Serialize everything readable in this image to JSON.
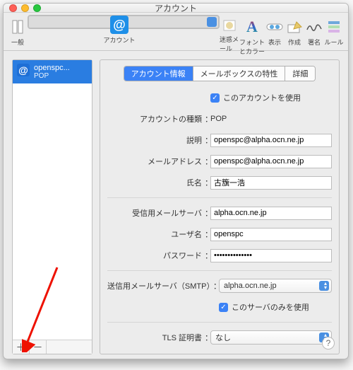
{
  "window": {
    "title": "アカウント"
  },
  "toolbar": {
    "items": [
      {
        "label": "一般"
      },
      {
        "label": "アカウント"
      },
      {
        "label": "迷惑メール"
      },
      {
        "label": "フォントとカラー"
      },
      {
        "label": "表示"
      },
      {
        "label": "作成"
      },
      {
        "label": "署名"
      },
      {
        "label": "ルール"
      }
    ]
  },
  "sidebar": {
    "accounts": [
      {
        "name": "openspc...",
        "type": "POP"
      }
    ],
    "add": "＋",
    "remove": "－"
  },
  "tabs": {
    "info": "アカウント情報",
    "mailbox": "メールボックスの特性",
    "details": "詳細"
  },
  "form": {
    "enable_label": "このアカウントを使用",
    "type_label": "アカウントの種類",
    "type_value": "POP",
    "desc_label": "説明",
    "desc_value": "openspc@alpha.ocn.ne.jp",
    "email_label": "メールアドレス",
    "email_value": "openspc@alpha.ocn.ne.jp",
    "fullname_label": "氏名",
    "fullname_value": "古籏一浩",
    "incoming_label": "受信用メールサーバ",
    "incoming_value": "alpha.ocn.ne.jp",
    "user_label": "ユーザ名",
    "user_value": "openspc",
    "pass_label": "パスワード",
    "pass_value": "••••••••••••••",
    "outgoing_label": "送信用メールサーバ（SMTP）",
    "outgoing_value": "alpha.ocn.ne.jp",
    "only_server_label": "このサーバのみを使用",
    "tls_label": "TLS 証明書",
    "tls_value": "なし"
  },
  "colon": "："
}
